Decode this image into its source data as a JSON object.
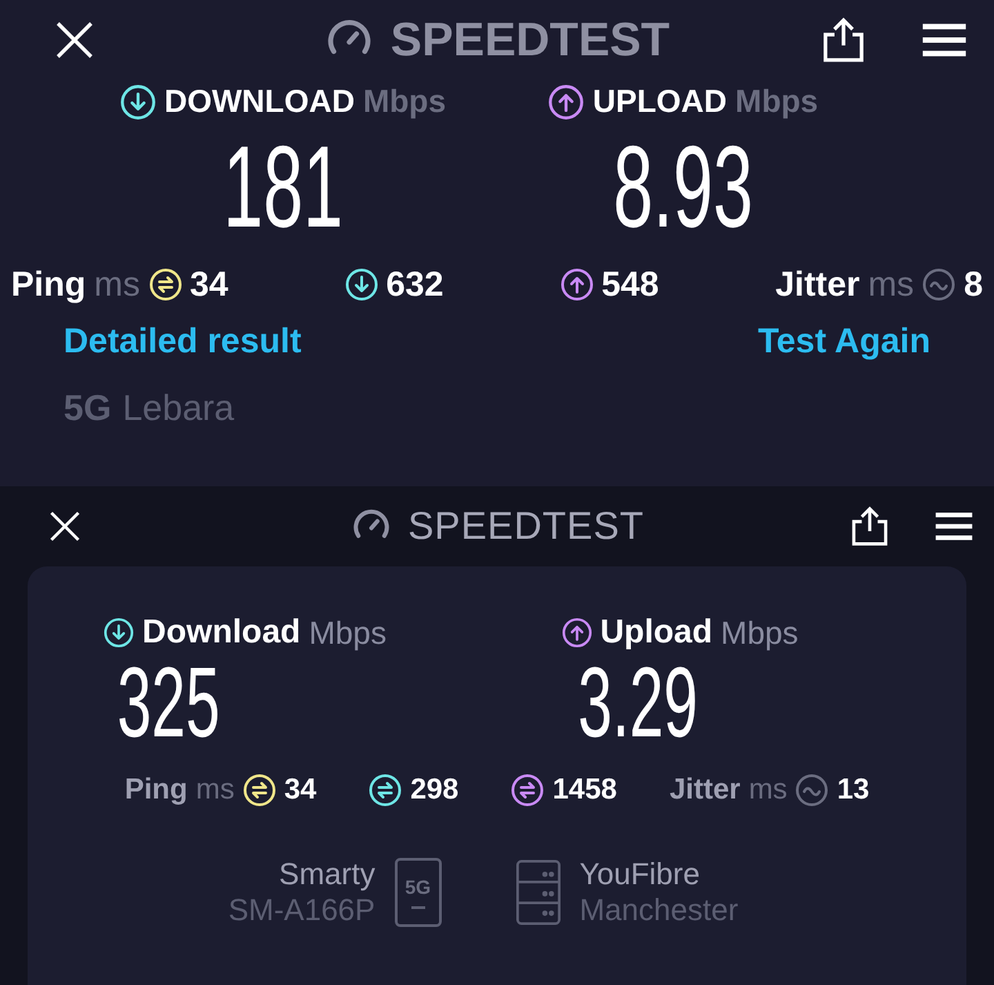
{
  "panels": [
    {
      "kind": "full",
      "header": {
        "title": "SPEEDTEST"
      },
      "download": {
        "label": "DOWNLOAD",
        "unit": "Mbps",
        "value": "181"
      },
      "upload": {
        "label": "UPLOAD",
        "unit": "Mbps",
        "value": "8.93"
      },
      "stats": [
        {
          "kind": "swap",
          "label": "Ping",
          "unit": "ms",
          "value": "34",
          "color": "#f0e68a"
        },
        {
          "kind": "down",
          "value": "632",
          "color": "#6ee6e6"
        },
        {
          "kind": "up",
          "value": "548",
          "color": "#c98af5"
        },
        {
          "kind": "wave",
          "label": "Jitter",
          "unit": "ms",
          "value": "8",
          "color": "#6b6d80"
        }
      ],
      "links": [
        "Detailed result",
        "Test Again"
      ],
      "network": {
        "type": "5G",
        "provider": "Lebara"
      }
    },
    {
      "kind": "card",
      "header": {
        "title": "SPEEDTEST"
      },
      "download": {
        "label": "Download",
        "unit": "Mbps",
        "value": "325"
      },
      "upload": {
        "label": "Upload",
        "unit": "Mbps",
        "value": "3.29"
      },
      "stats": [
        {
          "kind": "swap",
          "label": "Ping",
          "unit": "ms",
          "value": "34",
          "color": "#f0e68a"
        },
        {
          "kind": "swap",
          "value": "298",
          "color": "#6ee6e6"
        },
        {
          "kind": "swap",
          "value": "1458",
          "color": "#c98af5"
        },
        {
          "kind": "wave",
          "label": "Jitter",
          "unit": "ms",
          "value": "13",
          "color": "#6b6d80"
        }
      ],
      "carrier": {
        "name": "Smarty",
        "device": "SM-A166P",
        "badge": "5G"
      },
      "server": {
        "name": "YouFibre",
        "location": "Manchester"
      }
    }
  ]
}
